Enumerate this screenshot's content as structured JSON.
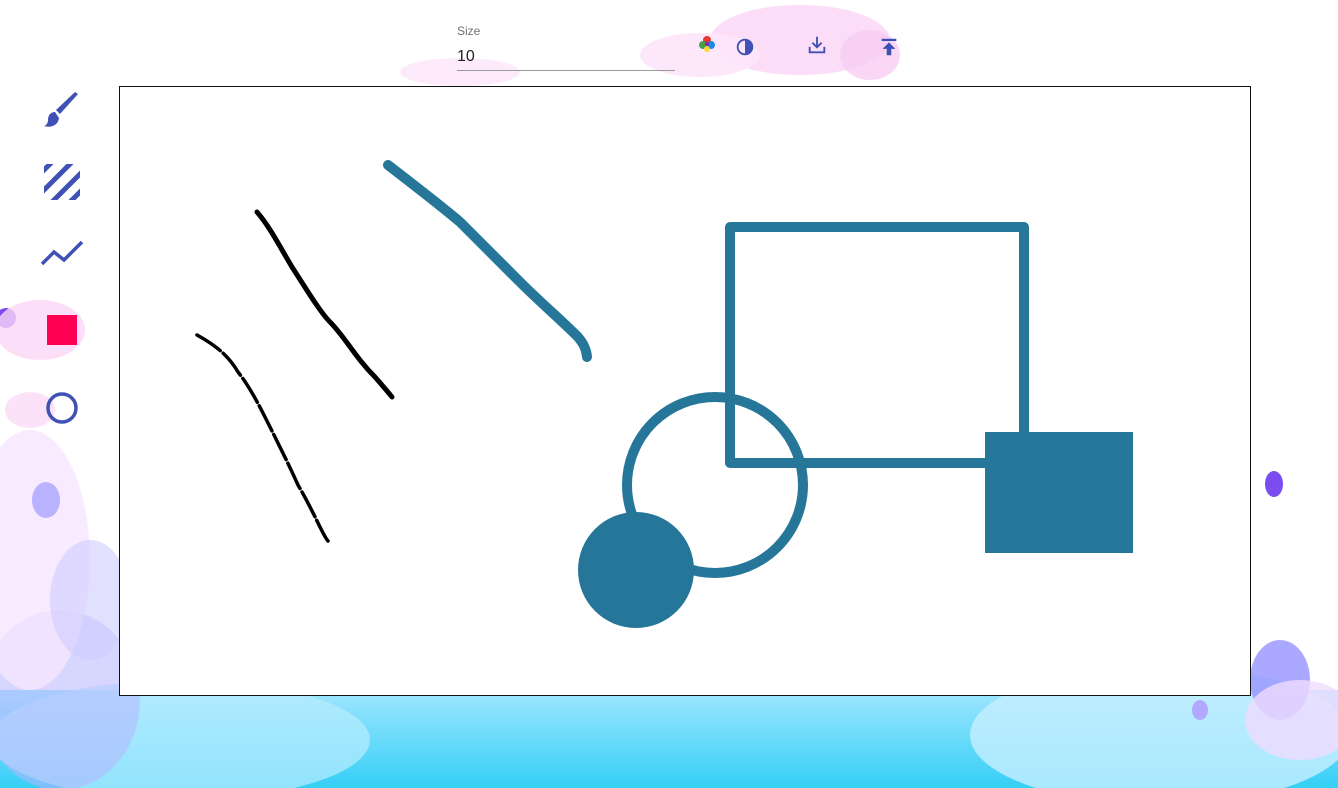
{
  "colors": {
    "tool_icon": "#3f51b5",
    "accent_fill": "#ff0055",
    "stroke_color": "#26769a",
    "pen_black": "#000000"
  },
  "toolbar": {
    "size_label": "Size",
    "size_value": "10",
    "color_picker_icon": "color-palette-icon",
    "contrast_icon": "contrast-icon",
    "download_icon": "download-icon",
    "upload_icon": "upload-icon"
  },
  "side_tools": [
    {
      "name": "brush",
      "icon": "brush-icon"
    },
    {
      "name": "pattern",
      "icon": "hatch-pattern-icon"
    },
    {
      "name": "line",
      "icon": "polyline-icon"
    },
    {
      "name": "rectangle",
      "icon": "filled-square-icon"
    },
    {
      "name": "circle",
      "icon": "circle-outline-icon"
    }
  ]
}
